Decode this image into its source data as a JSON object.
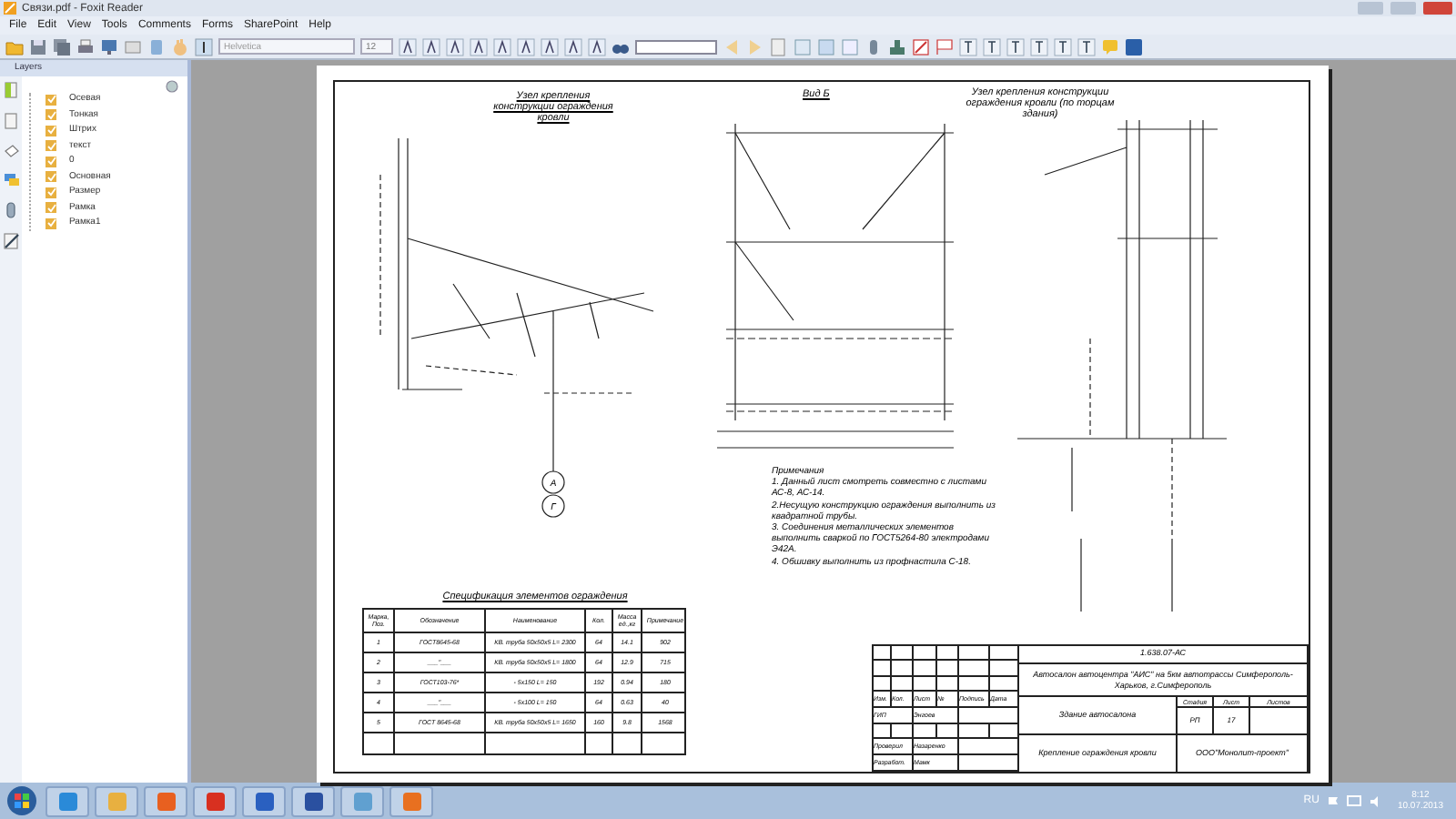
{
  "window": {
    "title": "Связи.pdf - Foxit Reader"
  },
  "menu": [
    "File",
    "Edit",
    "View",
    "Tools",
    "Comments",
    "Forms",
    "SharePoint",
    "Help"
  ],
  "toolbar": {
    "font_field": {
      "placeholder": "Helvetica"
    },
    "size_field": {
      "value": "12"
    }
  },
  "layers_panel": {
    "title": "Layers",
    "items": [
      {
        "label": "Осевая",
        "checked": true
      },
      {
        "label": "Тонкая",
        "checked": true
      },
      {
        "label": "Штрих",
        "checked": true
      },
      {
        "label": "текст",
        "checked": true
      },
      {
        "label": "0",
        "checked": true
      },
      {
        "label": "Основная",
        "checked": true
      },
      {
        "label": "Размер",
        "checked": true
      },
      {
        "label": "Рамка",
        "checked": true
      },
      {
        "label": "Рамка1",
        "checked": true
      }
    ]
  },
  "drawing": {
    "node_title_left": "Узел крепления конструкции ограждения кровли",
    "view_title": "Вид Б",
    "node_title_right": "Узел крепления конструкции ограждения кровли (по торцам здания)",
    "axis_marks": [
      "А",
      "Г"
    ]
  },
  "notes": {
    "heading": "Примечания",
    "items": [
      "1. Данный лист смотреть совместно с листами АС-8, АС-14.",
      "2.Несущую конструкцию ограждения выполнить из квадратной трубы.",
      "3. Соединения металлических элементов выполнить сваркой по ГОСТ5264-80 электродами Э42А.",
      "4. Обшивку выполнить из профнастила С-18."
    ]
  },
  "specification": {
    "title": "Спецификация элементов ограждения",
    "columns": [
      "Марка, Поз.",
      "Обозначение",
      "Наименование",
      "Кол.",
      "Масса ед.,кг",
      "Примечание"
    ],
    "rows": [
      [
        "1",
        "ГОСТ8645-68",
        "КВ. труба 50х50х5 L= 2300",
        "64",
        "14.1",
        "902"
      ],
      [
        "2",
        "___\"___",
        "КВ. труба 50х50х5 L= 1800",
        "64",
        "12.9",
        "715"
      ],
      [
        "3",
        "ГОСТ103-76*",
        "- 5х150 L= 150",
        "192",
        "0.94",
        "180"
      ],
      [
        "4",
        "___\"___",
        "- 5х100 L= 150",
        "64",
        "0.63",
        "40"
      ],
      [
        "5",
        "ГОСТ 8645-68",
        "КВ. труба 50х50х5 L= 1650",
        "160",
        "9.8",
        "1568"
      ]
    ]
  },
  "title_block": {
    "code": "1.638.07-АС",
    "project": "Автосалон автоцентра \"АИС\" на 5км автотрассы Симферополь-Харьков, г.Симферополь",
    "building": "Здание автосалона",
    "sheet_headers": [
      "Стадия",
      "Лист",
      "Листов"
    ],
    "sheet_values": [
      "РП",
      "17"
    ],
    "sheet_title": "Крепление ограждения кровли",
    "company": "ООО\"Монолит-проект\"",
    "revision_headers": [
      "Изм.",
      "Кол.",
      "Лист",
      "№",
      "Подпись",
      "Дата"
    ],
    "signatures": [
      [
        "ГИП",
        "Энгоев"
      ],
      [
        "Проверил",
        "Назаренко"
      ],
      [
        "Разработ.",
        "Мамк"
      ]
    ]
  },
  "taskbar": {
    "language": "RU",
    "time": "8:12",
    "date": "10.07.2013"
  }
}
